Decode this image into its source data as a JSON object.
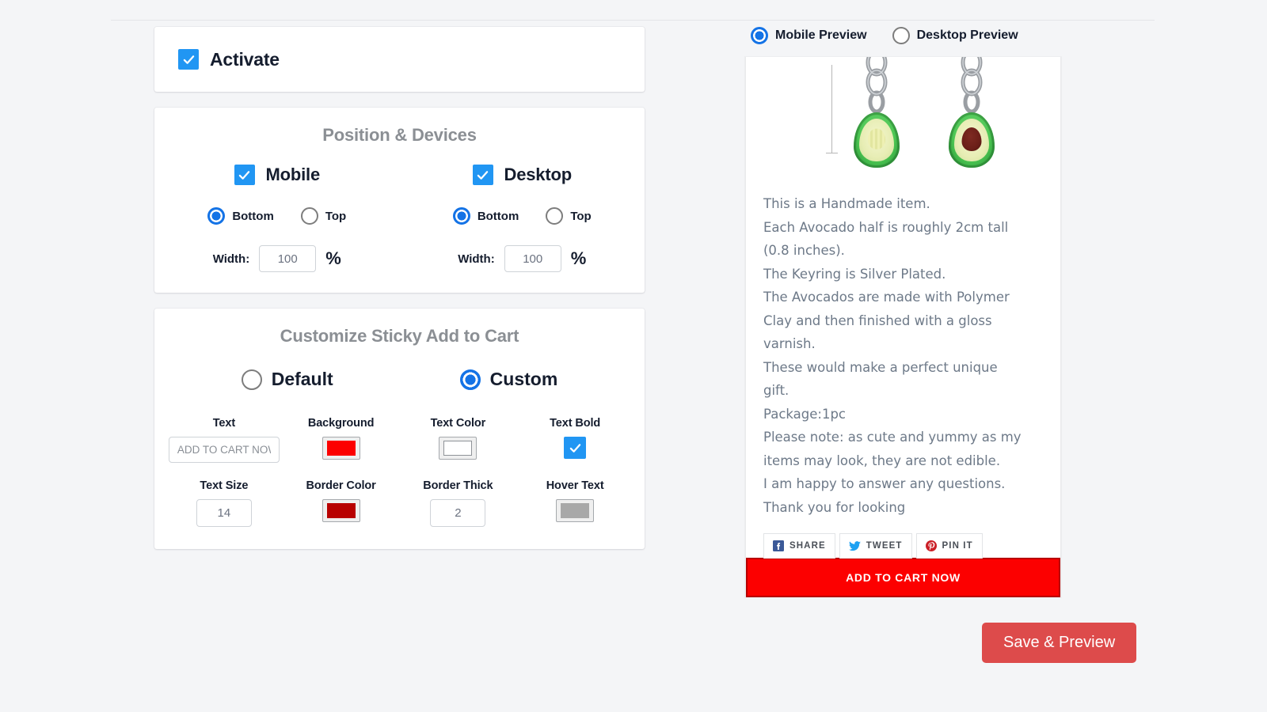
{
  "activate": {
    "label": "Activate",
    "checked": true
  },
  "position_card": {
    "title": "Position & Devices",
    "mobile": {
      "label": "Mobile",
      "checked": true,
      "position_selected": "Bottom",
      "options": [
        "Bottom",
        "Top"
      ],
      "width_label": "Width:",
      "width_value": "100",
      "width_unit": "%"
    },
    "desktop": {
      "label": "Desktop",
      "checked": true,
      "position_selected": "Bottom",
      "options": [
        "Bottom",
        "Top"
      ],
      "width_label": "Width:",
      "width_value": "100",
      "width_unit": "%"
    }
  },
  "customize_card": {
    "title": "Customize Sticky Add to Cart",
    "style_options": [
      {
        "label": "Default",
        "selected": false
      },
      {
        "label": "Custom",
        "selected": true
      }
    ],
    "fields": {
      "text": {
        "label": "Text",
        "value": "ADD TO CART NOW"
      },
      "background": {
        "label": "Background",
        "color": "#fc0000"
      },
      "text_color": {
        "label": "Text Color",
        "color": "#ffffff"
      },
      "text_bold": {
        "label": "Text Bold",
        "checked": true
      },
      "text_size": {
        "label": "Text Size",
        "value": "14"
      },
      "border_color": {
        "label": "Border Color",
        "color": "#b80000"
      },
      "border_thick": {
        "label": "Border Thick",
        "value": "2"
      },
      "hover_text": {
        "label": "Hover Text",
        "color": "#a8a8a8"
      }
    }
  },
  "preview": {
    "modes": [
      {
        "label": "Mobile Preview",
        "selected": true
      },
      {
        "label": "Desktop Preview",
        "selected": false
      }
    ],
    "description_lines": [
      "This is a Handmade item.",
      "Each Avocado half is roughly 2cm tall",
      "(0.8 inches).",
      "The Keyring is Silver Plated.",
      "The Avocados are made with Polymer",
      "Clay and then finished with a gloss",
      "varnish.",
      "These would make a perfect unique",
      "gift.",
      "Package:1pc",
      "Please note: as cute and yummy as my",
      "items may look, they are not edible.",
      "I am happy to answer any questions.",
      "Thank you for looking"
    ],
    "share_buttons": [
      {
        "label": "SHARE",
        "icon": "facebook-icon",
        "color": "#3b5998"
      },
      {
        "label": "TWEET",
        "icon": "twitter-icon",
        "color": "#1da1f2"
      },
      {
        "label": "PIN IT",
        "icon": "pinterest-icon",
        "color": "#cb2027"
      }
    ],
    "sticky_cart_label": "ADD TO CART NOW"
  },
  "actions": {
    "save_preview_label": "Save & Preview"
  }
}
